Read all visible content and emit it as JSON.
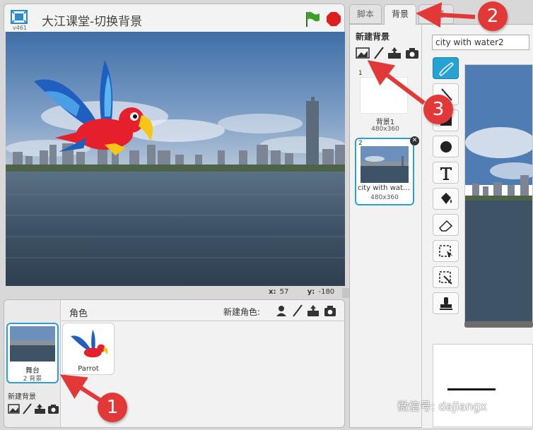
{
  "stage": {
    "title": "大江课堂-切换背景",
    "version": "v461",
    "x_label": "x:",
    "x_value": "57",
    "y_label": "y:",
    "y_value": "-180"
  },
  "sprites_pane": {
    "title": "角色",
    "new_sprite_label": "新建角色:",
    "stage_thumb_label": "舞台",
    "stage_backdrop_count": "2 背景",
    "new_backdrop_label": "新建背景",
    "sprites": [
      {
        "name": "Parrot"
      }
    ]
  },
  "tabs": [
    {
      "label": "脚本",
      "active": false
    },
    {
      "label": "背景",
      "active": true
    },
    {
      "label": "声音",
      "active": false
    }
  ],
  "backdrops_pane": {
    "title": "新建背景",
    "items": [
      {
        "index": "1",
        "name": "背景1",
        "size": "480x360"
      },
      {
        "index": "2",
        "name": "city with water2",
        "size": "480x360",
        "selected": true
      }
    ]
  },
  "paint_editor": {
    "costume_name": "city with water2"
  },
  "annotations": [
    {
      "label": "1"
    },
    {
      "label": "2"
    },
    {
      "label": "3"
    }
  ],
  "watermark": "微信号: dajiangx",
  "colors": {
    "accent": "#2ba0d8",
    "annotation": "#e23838",
    "stop": "#e01e1e",
    "flag": "#3e9d2b"
  }
}
